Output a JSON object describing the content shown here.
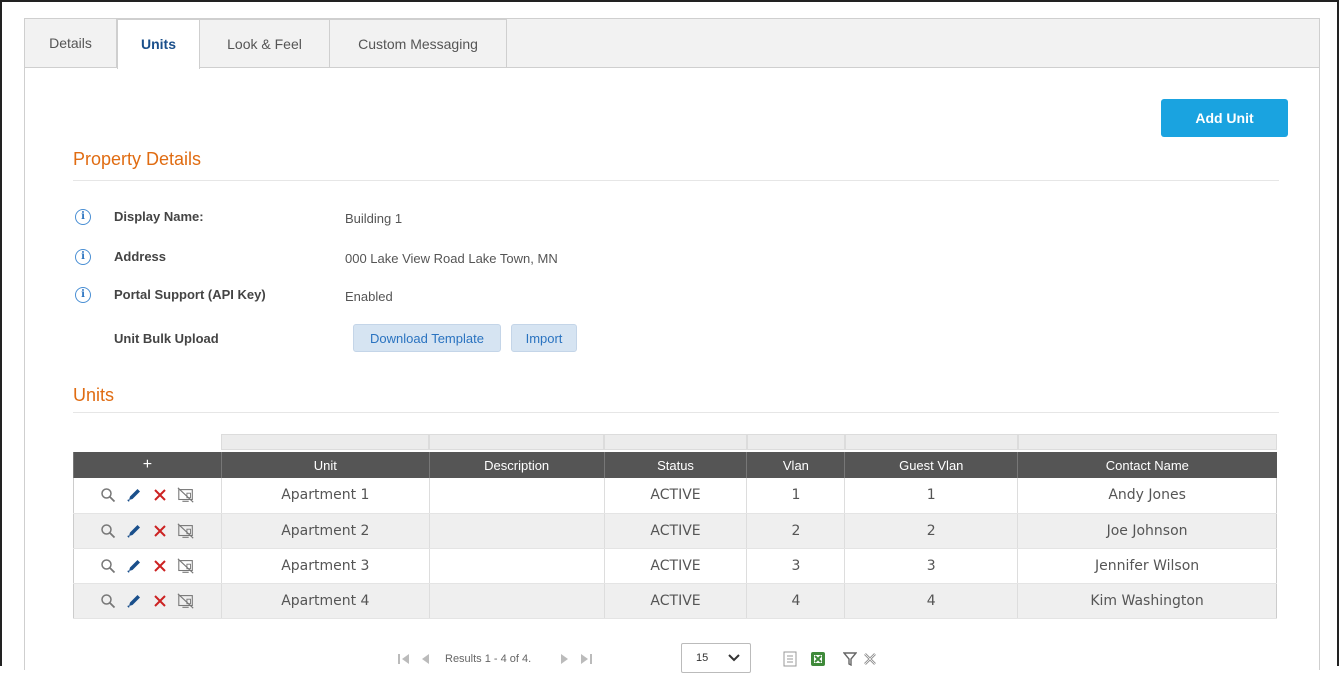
{
  "tabs": [
    {
      "label": "Details"
    },
    {
      "label": "Units"
    },
    {
      "label": "Look & Feel"
    },
    {
      "label": "Custom Messaging"
    }
  ],
  "add_unit_label": "Add Unit",
  "property": {
    "title": "Property Details",
    "rows": [
      {
        "label": "Display Name:",
        "value": "Building 1"
      },
      {
        "label": "Address",
        "value": "000 Lake View Road Lake Town, MN"
      },
      {
        "label": "Portal Support (API Key)",
        "value": "Enabled"
      },
      {
        "label": "Unit Bulk Upload"
      }
    ],
    "download_template_label": "Download Template",
    "import_label": "Import"
  },
  "units": {
    "title": "Units",
    "add_symbol": "+",
    "columns": [
      "Unit",
      "Description",
      "Status",
      "Vlan",
      "Guest Vlan",
      "Contact Name"
    ],
    "rows": [
      {
        "unit": "Apartment 1",
        "description": "",
        "status": "ACTIVE",
        "vlan": "1",
        "guest_vlan": "1",
        "contact": "Andy Jones"
      },
      {
        "unit": "Apartment 2",
        "description": "",
        "status": "ACTIVE",
        "vlan": "2",
        "guest_vlan": "2",
        "contact": "Joe Johnson"
      },
      {
        "unit": "Apartment 3",
        "description": "",
        "status": "ACTIVE",
        "vlan": "3",
        "guest_vlan": "3",
        "contact": "Jennifer Wilson"
      },
      {
        "unit": "Apartment 4",
        "description": "",
        "status": "ACTIVE",
        "vlan": "4",
        "guest_vlan": "4",
        "contact": "Kim Washington"
      }
    ]
  },
  "pager": {
    "results_text": "Results 1 - 4 of 4.",
    "page_size": "15"
  },
  "colors": {
    "accent": "#1aa3e0",
    "section_title": "#e06c12",
    "active_tab": "#1a4f8b",
    "edit_icon": "#1a4f8b",
    "delete_icon": "#cc2222"
  }
}
